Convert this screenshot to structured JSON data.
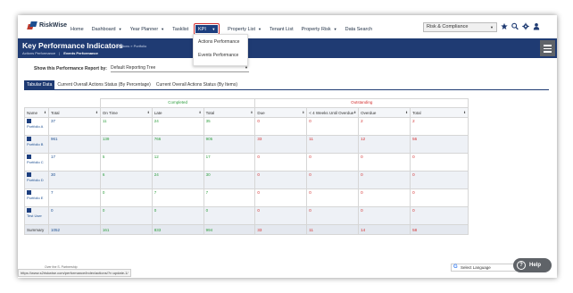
{
  "brand": {
    "name": "RiskWise",
    "logo_red": "#c0392b",
    "logo_blue": "#1d4f91"
  },
  "nav": {
    "items": [
      {
        "label": "Home",
        "caret": false
      },
      {
        "label": "Dashboard",
        "caret": true
      },
      {
        "label": "Year Planner",
        "caret": true
      },
      {
        "label": "Tasklist",
        "caret": false
      }
    ],
    "kpi_label": "KPI",
    "items_after": [
      {
        "label": "Property List",
        "caret": true
      },
      {
        "label": "Tenant List",
        "caret": false
      },
      {
        "label": "Property Risk",
        "caret": true
      },
      {
        "label": "Data Search",
        "caret": false
      }
    ],
    "module_select": "Risk & Compliance",
    "icons": [
      "star-icon",
      "search-icon",
      "gear-icon",
      "user-icon"
    ]
  },
  "dropdown": {
    "items": [
      "Actions Performance",
      "Events Performance"
    ]
  },
  "banner": {
    "title": "Key Performance Indicators",
    "crumb": "Actions » Portfolio",
    "subnav": [
      "Actions Performance",
      "|",
      "Events Performance"
    ]
  },
  "report": {
    "label": "Show this Performance Report by:",
    "value": "Default Reporting Tree"
  },
  "tabs": [
    "Tabular Data",
    "Current Overall Actions Status (By Percentage)",
    "Current Overall Actions Status (By Items)"
  ],
  "table": {
    "groups": {
      "completed": "Completed",
      "outstanding": "Outstanding"
    },
    "headers": [
      "Name",
      "Total",
      "On Time",
      "Late",
      "Total",
      "Due",
      "< 4 Weeks Until Overdue",
      "Overdue",
      "Total"
    ],
    "rows": [
      {
        "name": "Portfolio A",
        "values": [
          "37",
          "11",
          "24",
          "35",
          "0",
          "0",
          "2",
          "2"
        ]
      },
      {
        "name": "Portfolio B",
        "values": [
          "961",
          "139",
          "766",
          "905",
          "33",
          "11",
          "12",
          "56"
        ]
      },
      {
        "name": "Portfolio C",
        "values": [
          "17",
          "5",
          "12",
          "17",
          "0",
          "0",
          "0",
          "0"
        ]
      },
      {
        "name": "Portfolio D",
        "values": [
          "30",
          "6",
          "24",
          "30",
          "0",
          "0",
          "0",
          "0"
        ]
      },
      {
        "name": "Portfolio E",
        "values": [
          "7",
          "0",
          "7",
          "7",
          "0",
          "0",
          "0",
          "0"
        ]
      },
      {
        "name": "Test User",
        "values": [
          "0",
          "0",
          "0",
          "0",
          "0",
          "0",
          "0",
          "0"
        ]
      }
    ],
    "summary": {
      "name": "Summary",
      "values": [
        "1052",
        "161",
        "833",
        "994",
        "33",
        "11",
        "14",
        "58"
      ]
    }
  },
  "footer": {
    "status_url": "https://www.s2riskwise.com/performance/index/actions/?r=update-1/",
    "text": "Over the S. Partnership",
    "translate_label": "Select Language",
    "help_label": "Help"
  },
  "colors": {
    "navy": "#1f3b73",
    "green": "#2e9e3e",
    "red": "#d32f2f",
    "kpi_highlight": "#d32f2f"
  }
}
